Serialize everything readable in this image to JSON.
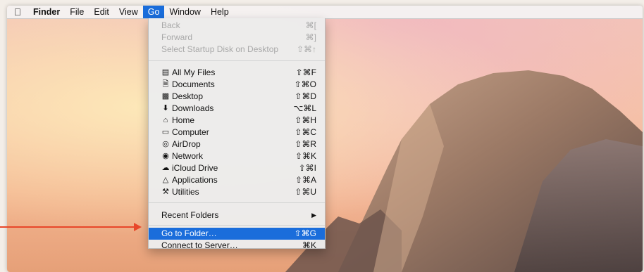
{
  "menubar": {
    "apple_icon": "apple-logo-icon",
    "items": [
      "Finder",
      "File",
      "Edit",
      "View",
      "Go",
      "Window",
      "Help"
    ],
    "active": "Go"
  },
  "go_menu": {
    "nav_items": [
      {
        "label": "Back",
        "shortcut": "⌘[",
        "enabled": false
      },
      {
        "label": "Forward",
        "shortcut": "⌘]",
        "enabled": false
      },
      {
        "label": "Select Startup Disk on Desktop",
        "shortcut": "⇧⌘↑",
        "enabled": false
      }
    ],
    "places": [
      {
        "label": "All My Files",
        "shortcut": "⇧⌘F",
        "icon": "all-files-icon"
      },
      {
        "label": "Documents",
        "shortcut": "⇧⌘O",
        "icon": "documents-icon"
      },
      {
        "label": "Desktop",
        "shortcut": "⇧⌘D",
        "icon": "desktop-icon"
      },
      {
        "label": "Downloads",
        "shortcut": "⌥⌘L",
        "icon": "downloads-icon"
      },
      {
        "label": "Home",
        "shortcut": "⇧⌘H",
        "icon": "home-icon"
      },
      {
        "label": "Computer",
        "shortcut": "⇧⌘C",
        "icon": "computer-icon"
      },
      {
        "label": "AirDrop",
        "shortcut": "⇧⌘R",
        "icon": "airdrop-icon"
      },
      {
        "label": "Network",
        "shortcut": "⇧⌘K",
        "icon": "network-icon"
      },
      {
        "label": "iCloud Drive",
        "shortcut": "⇧⌘I",
        "icon": "icloud-icon"
      },
      {
        "label": "Applications",
        "shortcut": "⇧⌘A",
        "icon": "applications-icon"
      },
      {
        "label": "Utilities",
        "shortcut": "⇧⌘U",
        "icon": "utilities-icon"
      }
    ],
    "recent_folders": {
      "label": "Recent Folders",
      "submenu_glyph": "▶"
    },
    "go_to_folder": {
      "label": "Go to Folder…",
      "shortcut": "⇧⌘G",
      "highlighted": true
    },
    "connect_to_server": {
      "label": "Connect to Server…",
      "shortcut": "⌘K"
    }
  },
  "colors": {
    "highlight": "#1a6ddb",
    "annotation_arrow": "#e8472a"
  }
}
